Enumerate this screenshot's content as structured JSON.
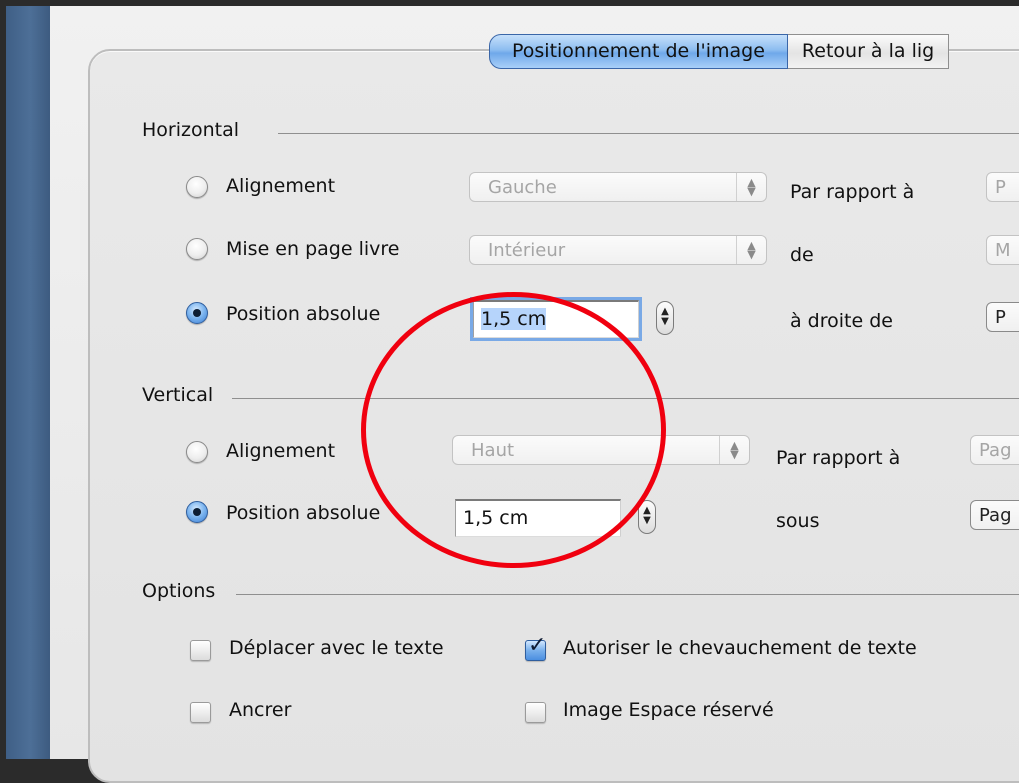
{
  "tabs": [
    {
      "label": "Positionnement de l'image",
      "active": true
    },
    {
      "label": "Retour à la lig",
      "active": false
    }
  ],
  "horizontal": {
    "title": "Horizontal",
    "rows": [
      {
        "radio_label": "Alignement",
        "checked": false,
        "control_value": "Gauche",
        "relation": "Par rapport à",
        "right_value": "P"
      },
      {
        "radio_label": "Mise en page livre",
        "checked": false,
        "control_value": "Intérieur",
        "relation": "de",
        "right_value": "M"
      },
      {
        "radio_label": "Position absolue",
        "checked": true,
        "control_value": "1,5 cm",
        "relation": "à droite de",
        "right_value": "P"
      }
    ]
  },
  "vertical": {
    "title": "Vertical",
    "rows": [
      {
        "radio_label": "Alignement",
        "checked": false,
        "control_value": "Haut",
        "relation": "Par rapport à",
        "right_value": "Pag"
      },
      {
        "radio_label": "Position absolue",
        "checked": true,
        "control_value": "1,5 cm",
        "relation": "sous",
        "right_value": "Pag"
      }
    ]
  },
  "options": {
    "title": "Options",
    "checkboxes": [
      {
        "label": "Déplacer avec le texte",
        "checked": false
      },
      {
        "label": "Autoriser le chevauchement de texte",
        "checked": true
      },
      {
        "label": "Ancrer",
        "checked": false
      },
      {
        "label": "Image Espace réservé",
        "checked": false
      }
    ]
  },
  "colors": {
    "annotation_circle": "#f0000f",
    "tab_active": "#8dbdf0",
    "sidebar": "#4d6f97"
  },
  "icons": {
    "radio": "radio-button",
    "checkbox": "checkbox",
    "popup_arrows": "updown-arrows-icon",
    "stepper": "stepper-icon"
  }
}
